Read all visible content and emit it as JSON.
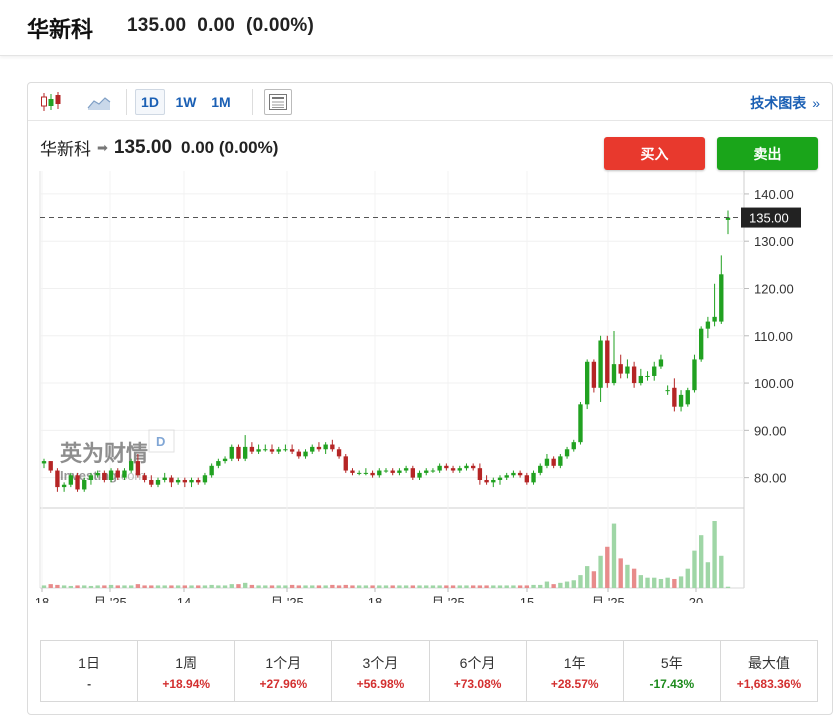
{
  "header": {
    "name": "华新科",
    "price": "135.00",
    "change": "0.00",
    "change_pct": "(0.00%)"
  },
  "toolbar": {
    "interval_1d": "1D",
    "interval_1w": "1W",
    "interval_1m": "1M",
    "tech_chart_label": "技术图表",
    "chevron": "»"
  },
  "legend": {
    "name": "华新科",
    "price": "135.00",
    "change": "0.00",
    "change_pct": "(0.00%)"
  },
  "actions": {
    "buy_label": "买入",
    "sell_label": "卖出"
  },
  "watermark": {
    "brand_cn": "英为财情",
    "brand_en": "Investing",
    "domain": ".com",
    "period_badge": "D"
  },
  "colors": {
    "up": "#21a121",
    "down": "#b52525",
    "vol_up": "#9fd6a6",
    "vol_down": "#e88b8b",
    "buy": "#e8392d",
    "sell": "#1aa51a",
    "link": "#1a5fb4"
  },
  "chart_data": {
    "type": "candlestick",
    "y_ticks": [
      "140.00",
      "130.00",
      "120.00",
      "110.00",
      "100.00",
      "90.00",
      "80.00"
    ],
    "ylim": [
      74,
      144
    ],
    "last_price_label": "135.00",
    "x_ticks": [
      "18",
      "月 '25",
      "14",
      "月 '25",
      "18",
      "月 '25",
      "15",
      "月 '25",
      "20"
    ],
    "candles": [
      [
        83,
        84,
        82,
        83.5
      ],
      [
        83.5,
        83.5,
        81,
        81.5
      ],
      [
        81.5,
        82,
        77,
        78
      ],
      [
        78,
        79,
        77,
        78.5
      ],
      [
        78.5,
        81,
        78,
        80.5
      ],
      [
        80.5,
        81,
        77,
        77.5
      ],
      [
        77.5,
        80,
        77,
        79.5
      ],
      [
        79.5,
        81,
        78.5,
        80.5
      ],
      [
        80.5,
        81.5,
        80,
        81
      ],
      [
        81,
        81.5,
        79,
        79.5
      ],
      [
        79.5,
        82,
        79,
        81.5
      ],
      [
        81.5,
        82,
        79.5,
        80
      ],
      [
        80,
        82,
        79.5,
        81.5
      ],
      [
        81.5,
        84,
        81,
        83.5
      ],
      [
        83.5,
        85,
        80,
        80.5
      ],
      [
        80.5,
        81,
        79,
        79.5
      ],
      [
        79.5,
        80.5,
        78,
        78.5
      ],
      [
        78.5,
        80,
        78,
        79.5
      ],
      [
        79.5,
        81,
        79,
        80
      ],
      [
        80,
        80.5,
        78,
        79
      ],
      [
        79,
        80,
        78.5,
        79.5
      ],
      [
        79.5,
        80,
        78,
        79
      ],
      [
        79,
        80,
        78,
        79.5
      ],
      [
        79.5,
        80,
        78.5,
        79
      ],
      [
        79,
        81,
        78.5,
        80.5
      ],
      [
        80.5,
        83,
        80,
        82.5
      ],
      [
        82.5,
        84,
        82,
        83.5
      ],
      [
        83.5,
        84.5,
        83,
        84
      ],
      [
        84,
        87,
        83.5,
        86.5
      ],
      [
        86.5,
        87,
        83.5,
        84
      ],
      [
        84,
        89,
        83.5,
        86.5
      ],
      [
        86.5,
        87.5,
        85,
        85.5
      ],
      [
        85.5,
        87,
        85,
        86
      ],
      [
        86,
        87,
        85.5,
        86
      ],
      [
        86,
        87,
        85,
        85.5
      ],
      [
        85.5,
        86.5,
        85,
        86
      ],
      [
        86,
        87,
        85.5,
        86
      ],
      [
        86,
        87,
        85,
        85.5
      ],
      [
        85.5,
        86,
        84,
        84.5
      ],
      [
        84.5,
        86,
        84,
        85.5
      ],
      [
        85.5,
        87,
        85,
        86.5
      ],
      [
        86.5,
        87.5,
        85.5,
        86
      ],
      [
        86,
        87.5,
        85,
        87
      ],
      [
        87,
        88,
        85.5,
        86
      ],
      [
        86,
        86.5,
        84,
        84.5
      ],
      [
        84.5,
        85,
        81,
        81.5
      ],
      [
        81.5,
        82,
        80.5,
        81
      ],
      [
        81,
        81.5,
        80.5,
        81
      ],
      [
        81,
        82,
        80.5,
        81
      ],
      [
        81,
        81.5,
        80,
        80.5
      ],
      [
        80.5,
        82,
        80,
        81.5
      ],
      [
        81.5,
        82,
        81,
        81.5
      ],
      [
        81.5,
        82,
        80.5,
        81
      ],
      [
        81,
        82,
        80.5,
        81.5
      ],
      [
        81.5,
        82.5,
        81,
        82
      ],
      [
        82,
        82.5,
        79.5,
        80
      ],
      [
        80,
        81.5,
        79.5,
        81
      ],
      [
        81,
        82,
        80.5,
        81.5
      ],
      [
        81.5,
        82,
        81,
        81.5
      ],
      [
        81.5,
        83,
        81,
        82.5
      ],
      [
        82.5,
        83,
        81.5,
        82
      ],
      [
        82,
        82.5,
        81,
        81.5
      ],
      [
        81.5,
        82.5,
        81,
        82
      ],
      [
        82,
        83,
        81.5,
        82.5
      ],
      [
        82.5,
        83,
        81.5,
        82
      ],
      [
        82,
        83,
        78.5,
        79.5
      ],
      [
        79.5,
        80.5,
        78.5,
        79
      ],
      [
        79,
        80,
        78,
        79.5
      ],
      [
        79.5,
        80.5,
        78.5,
        80
      ],
      [
        80,
        81,
        79.5,
        80.5
      ],
      [
        80.5,
        81.5,
        80,
        81
      ],
      [
        81,
        81.5,
        80,
        80.5
      ],
      [
        80.5,
        81,
        78.5,
        79
      ],
      [
        79,
        81.5,
        78.5,
        81
      ],
      [
        81,
        83,
        80.5,
        82.5
      ],
      [
        82.5,
        85,
        82,
        84
      ],
      [
        84,
        84.5,
        82,
        82.5
      ],
      [
        82.5,
        85,
        82,
        84.5
      ],
      [
        84.5,
        86.5,
        84,
        86
      ],
      [
        86,
        88,
        85.5,
        87.5
      ],
      [
        87.5,
        96,
        87,
        95.5
      ],
      [
        95.5,
        105,
        94.5,
        104.5
      ],
      [
        104.5,
        105,
        98,
        99
      ],
      [
        99,
        110,
        96,
        109
      ],
      [
        109,
        110,
        99,
        100
      ],
      [
        100,
        111,
        99.5,
        104
      ],
      [
        104,
        106,
        101,
        102
      ],
      [
        102,
        105,
        101,
        103.5
      ],
      [
        103.5,
        104.5,
        99,
        100
      ],
      [
        100,
        103,
        99.5,
        101.5
      ],
      [
        101.5,
        102.5,
        100.5,
        101.5
      ],
      [
        101.5,
        104.5,
        100.5,
        103.5
      ],
      [
        103.5,
        106,
        103,
        105
      ],
      [
        98.5,
        99.5,
        97.5,
        98.5
      ],
      [
        99,
        101,
        94,
        95
      ],
      [
        95,
        98.5,
        94,
        97.5
      ],
      [
        95.5,
        99,
        95,
        98.5
      ],
      [
        98.5,
        106,
        98,
        105
      ],
      [
        105,
        112,
        104.5,
        111.5
      ],
      [
        111.5,
        114,
        109.5,
        113
      ],
      [
        113,
        121,
        112,
        114
      ],
      [
        113,
        127,
        112.5,
        123
      ],
      [
        134.5,
        136.5,
        131.5,
        135
      ]
    ],
    "volumes": [
      0.1,
      0.15,
      0.12,
      0.1,
      0.08,
      0.1,
      0.1,
      0.08,
      0.1,
      0.1,
      0.12,
      0.1,
      0.1,
      0.1,
      0.15,
      0.1,
      0.1,
      0.1,
      0.1,
      0.1,
      0.1,
      0.1,
      0.1,
      0.1,
      0.1,
      0.12,
      0.1,
      0.1,
      0.15,
      0.15,
      0.2,
      0.12,
      0.1,
      0.1,
      0.1,
      0.1,
      0.1,
      0.12,
      0.1,
      0.1,
      0.1,
      0.1,
      0.1,
      0.12,
      0.1,
      0.12,
      0.1,
      0.1,
      0.1,
      0.1,
      0.1,
      0.1,
      0.1,
      0.1,
      0.1,
      0.1,
      0.1,
      0.1,
      0.1,
      0.1,
      0.1,
      0.1,
      0.1,
      0.1,
      0.1,
      0.1,
      0.1,
      0.1,
      0.1,
      0.1,
      0.1,
      0.1,
      0.1,
      0.12,
      0.12,
      0.25,
      0.15,
      0.2,
      0.25,
      0.3,
      0.5,
      0.85,
      0.65,
      1.25,
      1.6,
      2.5,
      1.15,
      0.9,
      0.75,
      0.5,
      0.4,
      0.4,
      0.35,
      0.4,
      0.35,
      0.45,
      0.75,
      1.45,
      2.05,
      1.0,
      2.6,
      1.25,
      0.05
    ],
    "volume_max": 2.6
  },
  "performance": [
    {
      "label": "1日",
      "value": "-",
      "dir": "neu"
    },
    {
      "label": "1周",
      "value": "+18.94%",
      "dir": "pos"
    },
    {
      "label": "1个月",
      "value": "+27.96%",
      "dir": "pos"
    },
    {
      "label": "3个月",
      "value": "+56.98%",
      "dir": "pos"
    },
    {
      "label": "6个月",
      "value": "+73.08%",
      "dir": "pos"
    },
    {
      "label": "1年",
      "value": "+28.57%",
      "dir": "pos"
    },
    {
      "label": "5年",
      "value": "-17.43%",
      "dir": "neg"
    },
    {
      "label": "最大值",
      "value": "+1,683.36%",
      "dir": "pos"
    }
  ]
}
